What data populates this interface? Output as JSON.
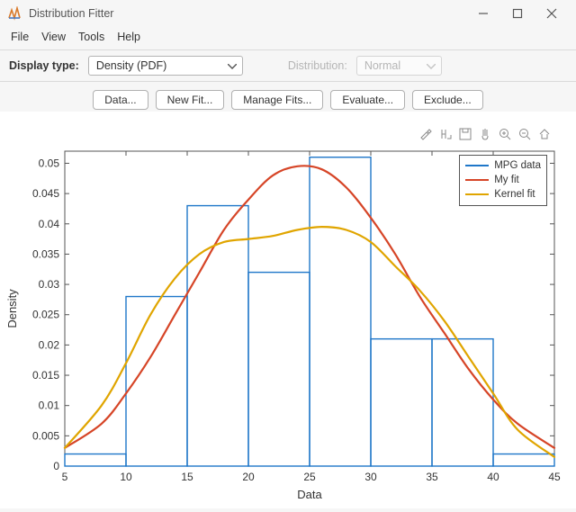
{
  "window": {
    "title": "Distribution Fitter",
    "buttons": {
      "minimize": "minimize",
      "maximize": "maximize",
      "close": "close"
    }
  },
  "menu": {
    "items": [
      "File",
      "View",
      "Tools",
      "Help"
    ]
  },
  "options": {
    "display_label": "Display type:",
    "display_value": "Density (PDF)",
    "distribution_label": "Distribution:",
    "distribution_value": "Normal",
    "distribution_enabled": false
  },
  "toolbar": {
    "data": "Data...",
    "newfit": "New Fit...",
    "managefits": "Manage Fits...",
    "evaluate": "Evaluate...",
    "exclude": "Exclude..."
  },
  "axes_toolbar": [
    "brush",
    "link",
    "save",
    "pan",
    "zoom-in",
    "zoom-out",
    "home"
  ],
  "legend": {
    "items": [
      {
        "label": "MPG data",
        "color": "#1f77c9"
      },
      {
        "label": "My fit",
        "color": "#d64527"
      },
      {
        "label": "Kernel fit",
        "color": "#e0a500"
      }
    ]
  },
  "chart_data": {
    "type": "bar",
    "title": "",
    "xlabel": "Data",
    "ylabel": "Density",
    "xlim": [
      5,
      45
    ],
    "ylim": [
      0,
      0.052
    ],
    "xticks": [
      5,
      10,
      15,
      20,
      25,
      30,
      35,
      40,
      45
    ],
    "yticks": [
      0,
      0.005,
      0.01,
      0.015,
      0.02,
      0.025,
      0.03,
      0.035,
      0.04,
      0.045,
      0.05
    ],
    "bars": {
      "name": "MPG data",
      "color": "#1f77c9",
      "edges": [
        5,
        10,
        15,
        20,
        25,
        30,
        35,
        40,
        45
      ],
      "heights": [
        0.002,
        0.028,
        0.043,
        0.032,
        0.051,
        0.021,
        0.021,
        0.002
      ]
    },
    "series": [
      {
        "name": "My fit",
        "color": "#d64527",
        "type": "line",
        "x": [
          5,
          8,
          10,
          12,
          14,
          16,
          18,
          20,
          22,
          24,
          26,
          28,
          30,
          32,
          34,
          36,
          38,
          40,
          42,
          45
        ],
        "y": [
          0.003,
          0.007,
          0.012,
          0.018,
          0.025,
          0.032,
          0.039,
          0.044,
          0.048,
          0.0495,
          0.049,
          0.046,
          0.041,
          0.035,
          0.028,
          0.022,
          0.016,
          0.011,
          0.007,
          0.003
        ]
      },
      {
        "name": "Kernel fit",
        "color": "#e0a500",
        "type": "line",
        "x": [
          5,
          8,
          10,
          12,
          14,
          16,
          18,
          20,
          22,
          24,
          26,
          28,
          30,
          32,
          34,
          36,
          38,
          40,
          42,
          45
        ],
        "y": [
          0.003,
          0.01,
          0.017,
          0.025,
          0.031,
          0.035,
          0.037,
          0.0375,
          0.038,
          0.039,
          0.0395,
          0.039,
          0.037,
          0.033,
          0.029,
          0.024,
          0.018,
          0.012,
          0.006,
          0.0015
        ]
      }
    ]
  }
}
